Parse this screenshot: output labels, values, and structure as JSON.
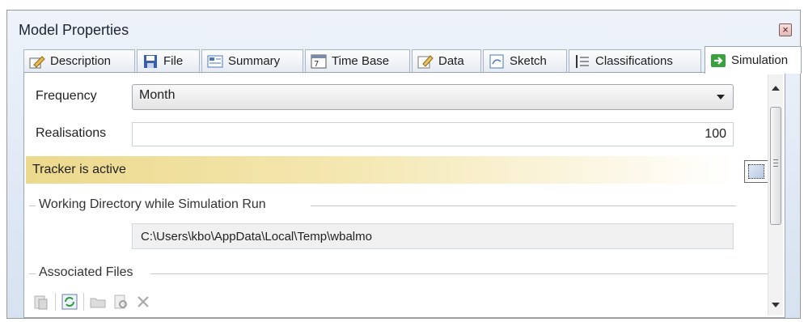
{
  "window": {
    "title": "Model Properties",
    "close_glyph": "×"
  },
  "tabs": [
    {
      "label": "Description",
      "icon": "pencil-note-icon",
      "active": false
    },
    {
      "label": "File",
      "icon": "floppy-disk-icon",
      "active": false
    },
    {
      "label": "Summary",
      "icon": "summary-table-icon",
      "active": false
    },
    {
      "label": "Time Base",
      "icon": "calendar-icon",
      "active": false
    },
    {
      "label": "Data",
      "icon": "data-edit-icon",
      "active": false
    },
    {
      "label": "Sketch",
      "icon": "sketch-icon",
      "active": false
    },
    {
      "label": "Classifications",
      "icon": "classification-list-icon",
      "active": false
    },
    {
      "label": "Simulation",
      "icon": "green-arrow-icon",
      "active": true
    }
  ],
  "simulation": {
    "frequency_label": "Frequency",
    "frequency_value": "Month",
    "realisations_label": "Realisations",
    "realisations_value": "100",
    "tracker_text": "Tracker is active",
    "working_dir_group": "Working Directory while Simulation Run",
    "working_dir_value": "C:\\Users\\kbo\\AppData\\Local\\Temp\\wbalmo",
    "associated_files_group": "Associated Files",
    "toolbar_icons": [
      "add-file-icon",
      "refresh-icon",
      "open-folder-icon",
      "view-file-icon",
      "delete-icon"
    ]
  },
  "colors": {
    "tracker_bar": "#ecd98d",
    "active_tab": "#ffffff"
  }
}
